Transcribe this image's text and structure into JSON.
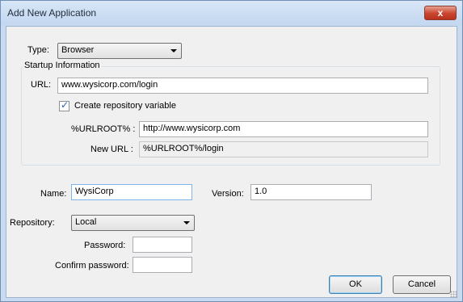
{
  "window": {
    "title": "Add New Application",
    "close_label": "x"
  },
  "type": {
    "label": "Type:",
    "value": "Browser"
  },
  "startup": {
    "group_title": "Startup Information",
    "url_label": "URL:",
    "url_value": "www.wysicorp.com/login",
    "create_var_label": "Create repository variable",
    "create_var_checked": true,
    "urlroot_label": "%URLROOT% :",
    "urlroot_value": "http://www.wysicorp.com",
    "newurl_label": "New URL :",
    "newurl_value": "%URLROOT%/login"
  },
  "details": {
    "name_label": "Name:",
    "name_value": "WysiCorp",
    "version_label": "Version:",
    "version_value": "1.0",
    "repository_label": "Repository:",
    "repository_value": "Local",
    "password_label": "Password:",
    "password_value": "",
    "confirm_label": "Confirm password:",
    "confirm_value": ""
  },
  "buttons": {
    "ok": "OK",
    "cancel": "Cancel"
  }
}
